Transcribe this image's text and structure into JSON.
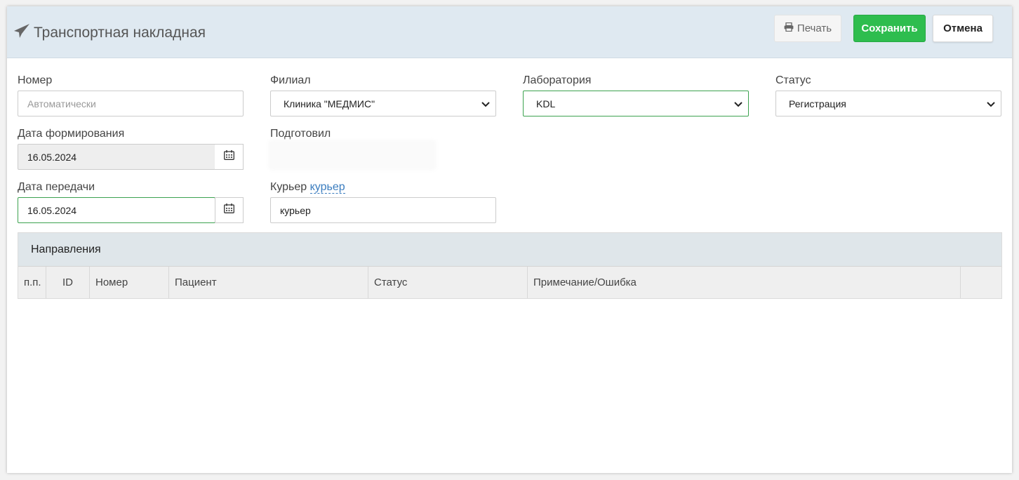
{
  "header": {
    "title": "Транспортная накладная",
    "print_label": "Печать",
    "save_label": "Сохранить",
    "cancel_label": "Отмена"
  },
  "form": {
    "number": {
      "label": "Номер",
      "placeholder": "Автоматически"
    },
    "branch": {
      "label": "Филиал",
      "value": "Клиника \"МЕДМИС\""
    },
    "laboratory": {
      "label": "Лаборатория",
      "value": "KDL"
    },
    "status": {
      "label": "Статус",
      "value": "Регистрация"
    },
    "date_formed": {
      "label": "Дата формирования",
      "value": "16.05.2024"
    },
    "prepared_by": {
      "label": "Подготовил"
    },
    "date_transfer": {
      "label": "Дата передачи",
      "value": "16.05.2024"
    },
    "courier": {
      "label": "Курьер",
      "link": "курьер",
      "value": "курьер"
    }
  },
  "directions": {
    "title": "Направления",
    "columns": [
      "п.п.",
      "ID",
      "Номер",
      "Пациент",
      "Статус",
      "Примечание/Ошибка",
      ""
    ]
  },
  "colors": {
    "header_bg": "#dfe9f1",
    "save_green": "#2ebd4e",
    "focus_border": "#3ca24f",
    "link_blue": "#3b7dbf"
  }
}
